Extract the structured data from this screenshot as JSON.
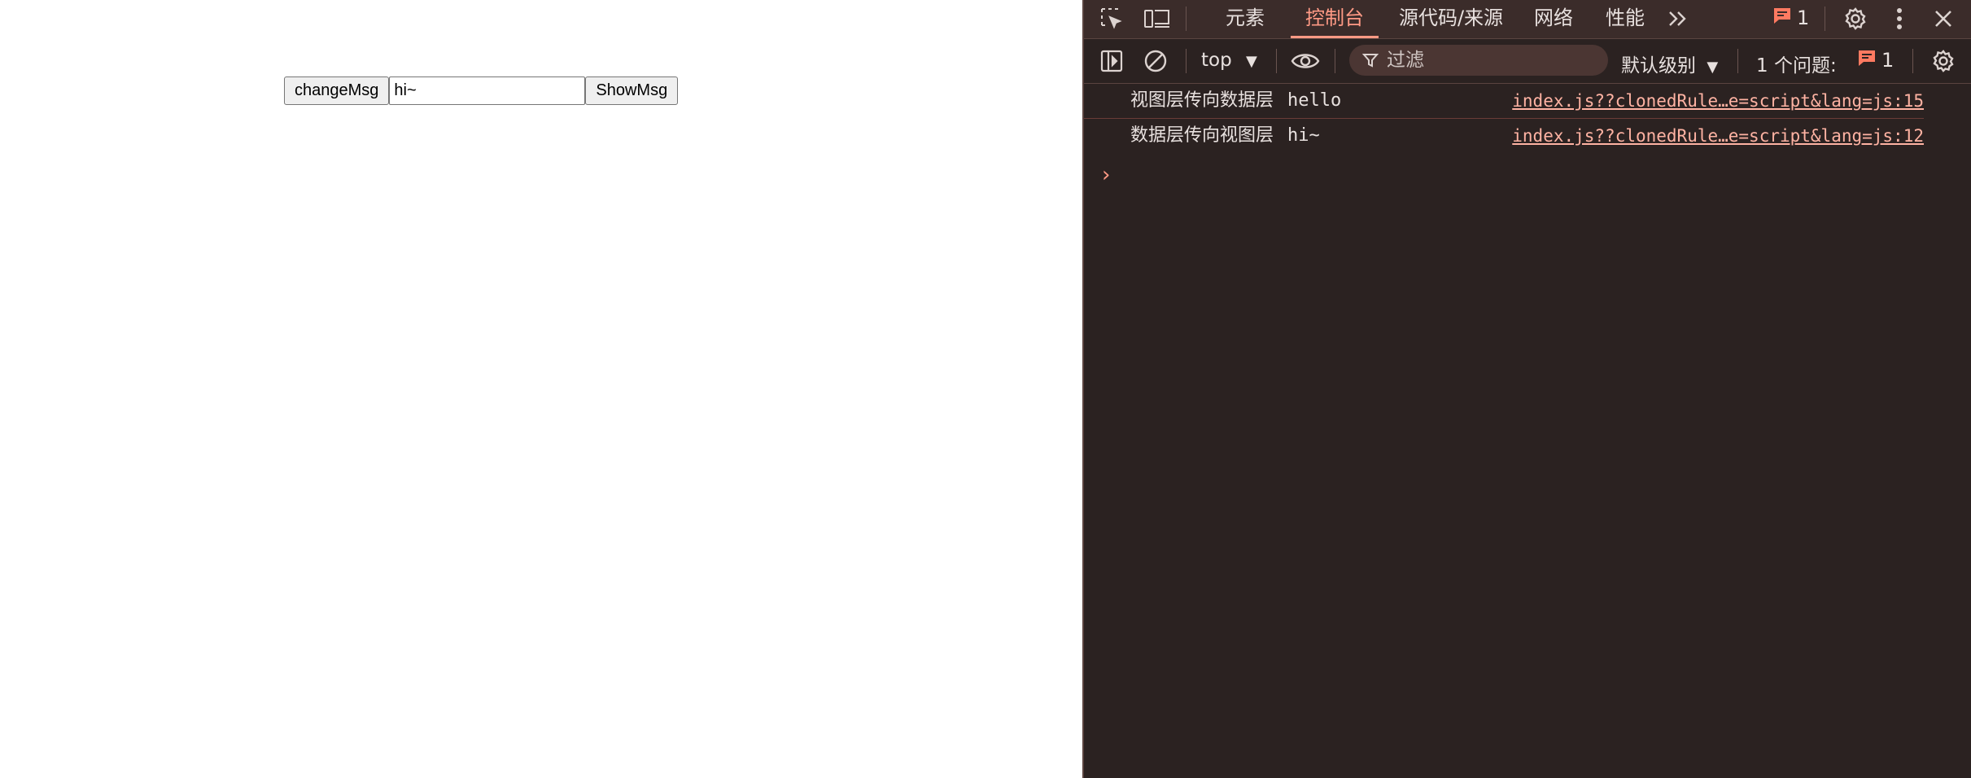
{
  "page": {
    "change_button": "changeMsg",
    "input_value": "hi~",
    "show_button": "ShowMsg"
  },
  "devtools": {
    "tabs": [
      {
        "label": "元素",
        "active": false
      },
      {
        "label": "控制台",
        "active": true
      },
      {
        "label": "源代码/来源",
        "active": false
      },
      {
        "label": "网络",
        "active": false
      },
      {
        "label": "性能",
        "active": false
      }
    ],
    "message_count": "1",
    "toolbar": {
      "context": "top",
      "filter_placeholder": "过滤",
      "level": "默认级别",
      "issues_label": "1 个问题:",
      "issues_count": "1"
    },
    "logs": [
      {
        "label": "视图层传向数据层",
        "value": "hello",
        "source": "index.js??clonedRule…e=script&lang=js:15"
      },
      {
        "label": "数据层传向视图层",
        "value": "hi~",
        "source": "index.js??clonedRule…e=script&lang=js:12"
      }
    ],
    "colors": {
      "accent": "#ff9a85",
      "background": "#2b2221",
      "tabbar": "#3b2c2a"
    },
    "icons": [
      "inspect-element-icon",
      "device-toolbar-icon",
      "more-tabs-icon",
      "message-icon",
      "settings-icon",
      "kebab-menu-icon",
      "close-icon",
      "sidebar-toggle-icon",
      "clear-console-icon",
      "dropdown-arrow-icon",
      "eye-icon",
      "filter-icon",
      "console-settings-icon",
      "prompt-chevron-icon"
    ]
  }
}
